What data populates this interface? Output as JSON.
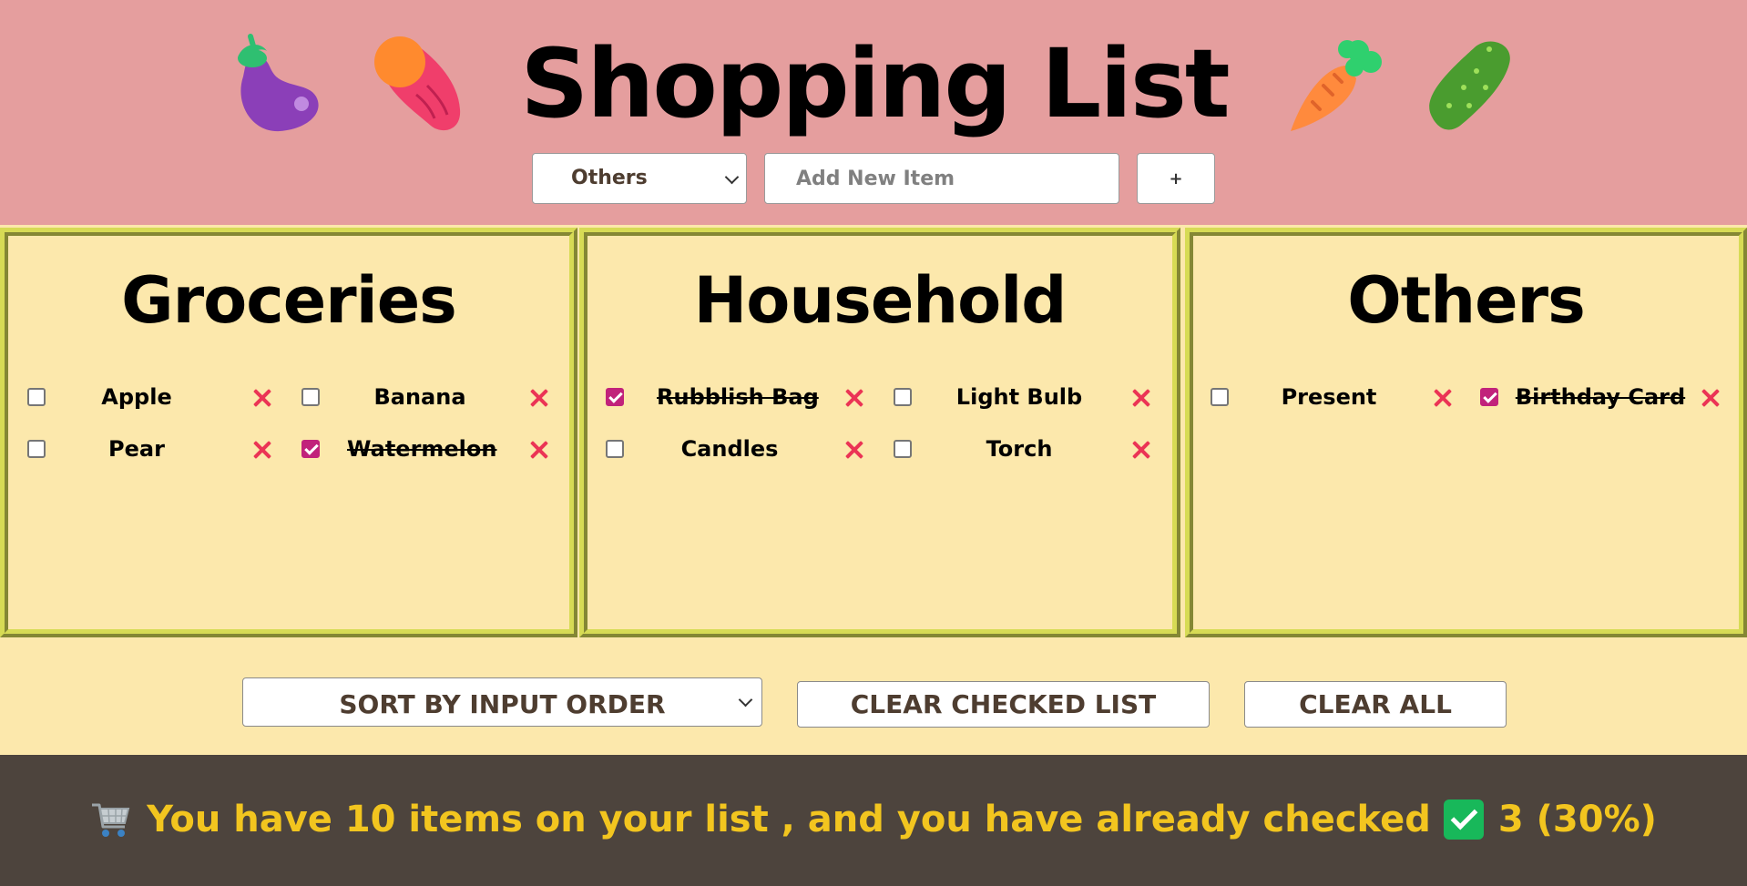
{
  "header": {
    "title": "Shopping List",
    "category_select": {
      "selected": "Others"
    },
    "new_item_input": {
      "placeholder": "Add New Item",
      "value": ""
    },
    "add_button_label": "+"
  },
  "lists": [
    {
      "title": "Groceries",
      "items": [
        {
          "name": "Apple",
          "checked": false
        },
        {
          "name": "Banana",
          "checked": false
        },
        {
          "name": "Pear",
          "checked": false
        },
        {
          "name": "Watermelon",
          "checked": true
        }
      ]
    },
    {
      "title": "Household",
      "items": [
        {
          "name": "Rubblish Bag",
          "checked": true
        },
        {
          "name": "Light Bulb",
          "checked": false
        },
        {
          "name": "Candles",
          "checked": false
        },
        {
          "name": "Torch",
          "checked": false
        }
      ]
    },
    {
      "title": "Others",
      "items": [
        {
          "name": "Present",
          "checked": false
        },
        {
          "name": "Birthday Card",
          "checked": true
        }
      ]
    }
  ],
  "controls": {
    "sort_select": "SORT BY INPUT ORDER",
    "clear_checked_label": "CLEAR CHECKED LIST",
    "clear_all_label": "CLEAR ALL"
  },
  "footer": {
    "message": "You have 10 items on your list , and you have already checked",
    "checked_summary": "3 (30%)"
  },
  "colors": {
    "header_bg": "#e59e9e",
    "panel_bg": "#fce8ac",
    "panel_border": "#d7db55",
    "footer_bg": "#4d443d",
    "footer_text": "#f2c51f",
    "checkbox_checked": "#c1227b",
    "delete_x": "#eb3455"
  },
  "icons": [
    "eggplant-icon",
    "sweet-potato-icon",
    "carrot-icon",
    "cucumber-icon",
    "shopping-cart-icon",
    "check-mark-button-icon",
    "delete-x-icon",
    "chevron-down-icon"
  ]
}
